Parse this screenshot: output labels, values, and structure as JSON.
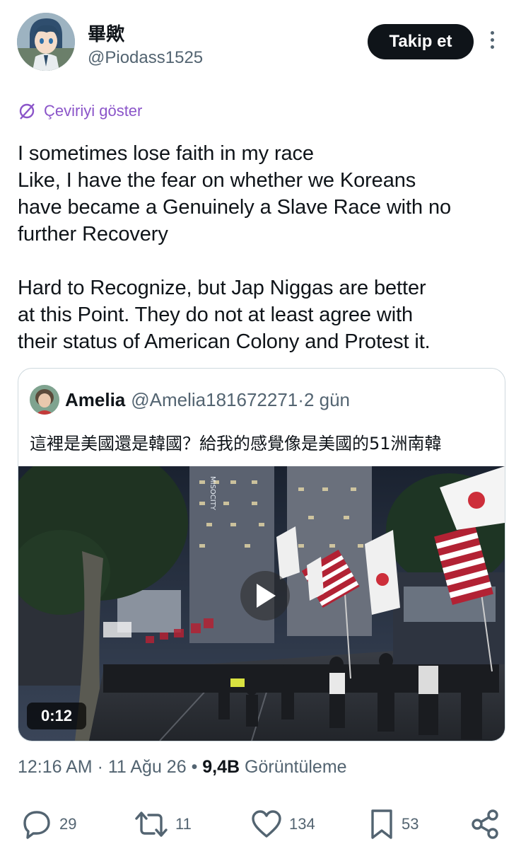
{
  "author": {
    "display_name": "畢歟",
    "handle": "@Piodass1525"
  },
  "header": {
    "follow_label": "Takip et",
    "more_icon": "more-vertical-icon"
  },
  "translate": {
    "label": "Çeviriyi göster",
    "icon": "translate-icon"
  },
  "tweet": {
    "text": "I sometimes lose faith in my race\nLike, I have the fear on whether we Koreans\nhave became a Genuinely a Slave Race with no\nfurther Recovery\n\nHard to Recognize, but Jap Niggas are better\nat this Point. They do not at least agree with\ntheir status of American Colony and Protest it."
  },
  "quote": {
    "name": "Amelia",
    "handle": "@Amelia181672271",
    "separator": " · ",
    "time": "2 gün",
    "text": "這裡是美國還是韓國？給我的感覺像是美國的51洲南韓",
    "video": {
      "duration": "0:12",
      "building_sign": "MISOCITY"
    }
  },
  "meta": {
    "time": "12:16 AM",
    "dot1": " · ",
    "date": "11 Ağu 26",
    "dot2": " • ",
    "views_count": "9,4B",
    "views_label": " Görüntüleme"
  },
  "actions": {
    "replies": "29",
    "reposts": "11",
    "likes": "134",
    "bookmarks": "53"
  },
  "colors": {
    "text": "#0f1419",
    "secondary": "#536471",
    "translate": "#8b55c9",
    "border": "#cfd9de",
    "button": "#0f1419"
  }
}
